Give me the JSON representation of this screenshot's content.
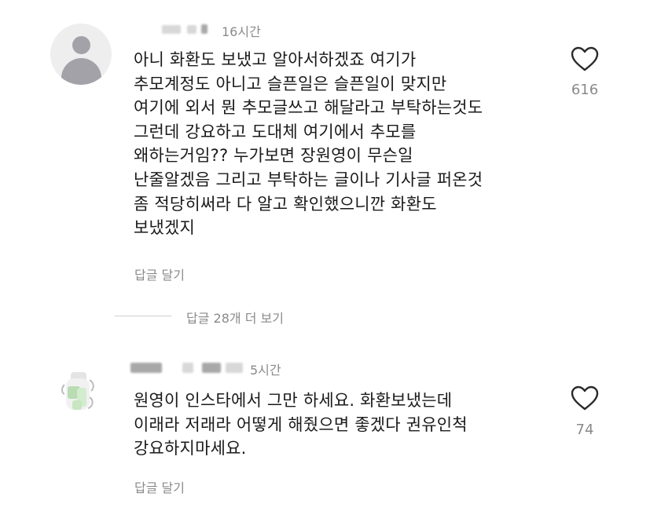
{
  "comments": [
    {
      "time": "16시간",
      "text": "아니 화환도 보냈고 알아서하겠죠 여기가\n추모계정도 아니고 슬픈일은 슬픈일이 맞지만\n여기에 외서 뭔 추모글쓰고 해달라고 부탁하는것도\n그런데 강요하고 도대체 여기에서 추모를\n왜하는거임?? 누가보면 장원영이 무슨일\n난줄알겠음 그리고 부탁하는 글이나 기사글 퍼온것\n좀 적당히써라 다 알고 확인했으니깐 화환도\n보냈겠지",
      "likes": "616",
      "reply_label": "답글 달기",
      "avatar_icon": "default-user-icon",
      "like_icon": "heart-outline-icon"
    },
    {
      "time": "5시간",
      "text": "원영이 인스타에서 그만 하세요. 화환보냈는데\n이래라 저래라 어떻게 해줬으면 좋겠다 권유인척\n강요하지마세요.",
      "likes": "74",
      "reply_label": "답글 달기",
      "avatar_icon": "blurred-avatar-icon",
      "like_icon": "heart-outline-icon"
    }
  ],
  "view_replies": {
    "label": "답글 28개 더 보기"
  },
  "colors": {
    "text": "#1a1a1a",
    "muted": "#8a8a8a",
    "background": "#ffffff"
  }
}
